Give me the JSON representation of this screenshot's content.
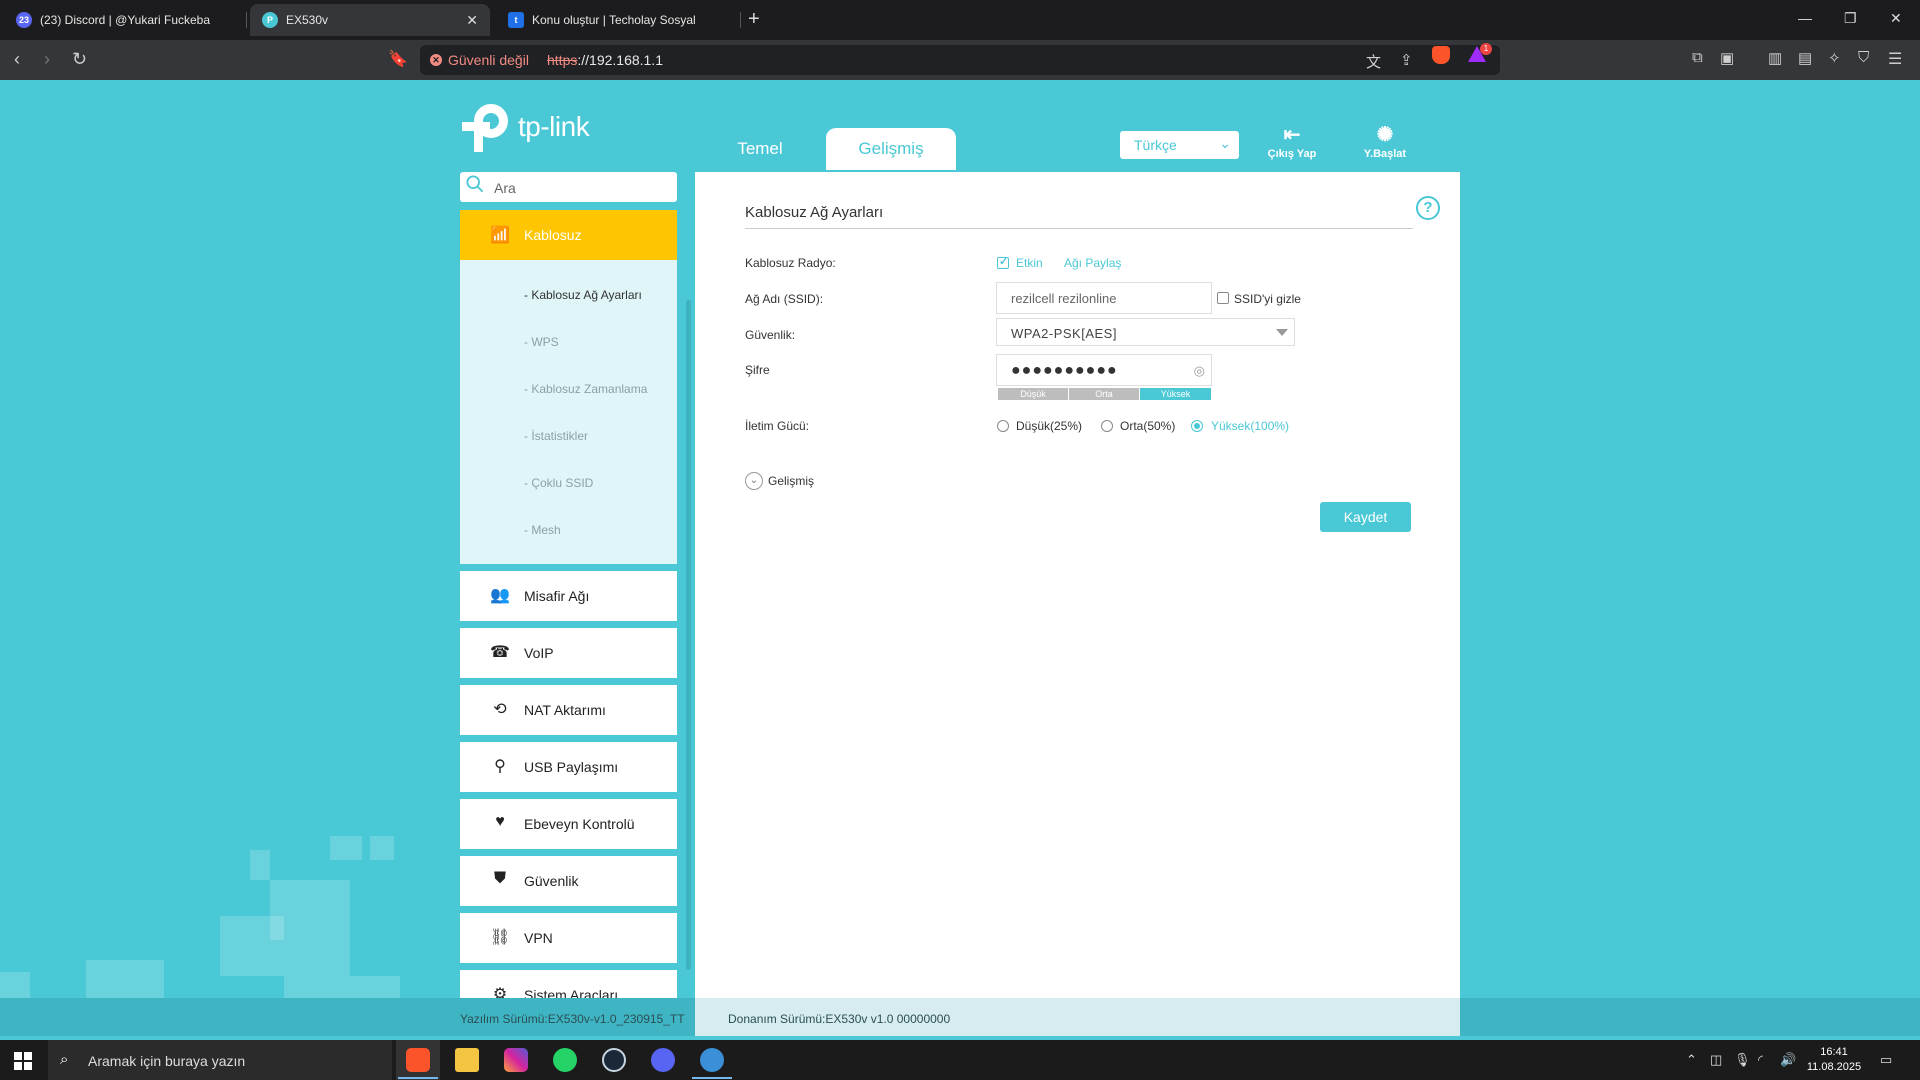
{
  "browser": {
    "tabs": [
      {
        "title": "(23) Discord | @Yukari Fuckeba",
        "badge": "23",
        "color": "#5865f2"
      },
      {
        "title": "EX530v",
        "color": "#4ac8d6"
      },
      {
        "title": "Konu oluştur | Techolay Sosyal",
        "badge": "t",
        "color": "#1e6fe8"
      }
    ],
    "new_tab": "+",
    "security_label": "Güvenli değil",
    "url_scheme": "https",
    "url_rest": "://192.168.1.1",
    "window_controls": {
      "minimize": "—",
      "restore": "❐",
      "close": "✕"
    }
  },
  "router": {
    "brand": "tp-link",
    "nav": {
      "basic": "Temel",
      "advanced": "Gelişmiş"
    },
    "language": "Türkçe",
    "logout": "Çıkış Yap",
    "reboot": "Y.Başlat",
    "search_placeholder": "Ara",
    "sidebar": {
      "active": "Kablosuz",
      "sub_items": [
        "- Kablosuz Ağ Ayarları",
        "- WPS",
        "- Kablosuz Zamanlama",
        "- İstatistikler",
        "- Çoklu SSID",
        "- Mesh"
      ],
      "items": [
        "Misafir Ağı",
        "VoIP",
        "NAT Aktarımı",
        "USB Paylaşımı",
        "Ebeveyn Kontrolü",
        "Güvenlik",
        "VPN",
        "Sistem Araçları"
      ]
    },
    "content": {
      "title": "Kablosuz Ağ Ayarları",
      "help": "?",
      "radio_label": "Kablosuz Radyo:",
      "radio_enable": "Etkin",
      "share_network": "Ağı Paylaş",
      "ssid_label": "Ağ Adı (SSID):",
      "ssid_value": "rezilcell rezilonline",
      "hide_ssid": "SSID'yi gizle",
      "security_label": "Güvenlik:",
      "security_value": "WPA2-PSK[AES]",
      "password_label": "Şifre",
      "password_value": "●●●●●●●●●●",
      "strength": [
        "Düşük",
        "Orta",
        "Yüksek"
      ],
      "power_label": "İletim Gücü:",
      "power_options": [
        "Düşük(25%)",
        "Orta(50%)",
        "Yüksek(100%)"
      ],
      "power_selected": 2,
      "advanced": "Gelişmiş",
      "save": "Kaydet"
    },
    "footer": {
      "firmware": "Yazılım Sürümü:EX530v-v1.0_230915_TT",
      "hardware": "Donanım Sürümü:EX530v v1.0 00000000"
    }
  },
  "taskbar": {
    "search_placeholder": "Aramak için buraya yazın",
    "time": "16:41",
    "date": "11.08.2025"
  },
  "colors": {
    "accent": "#4ac8d6",
    "active_menu": "#fdc600"
  }
}
